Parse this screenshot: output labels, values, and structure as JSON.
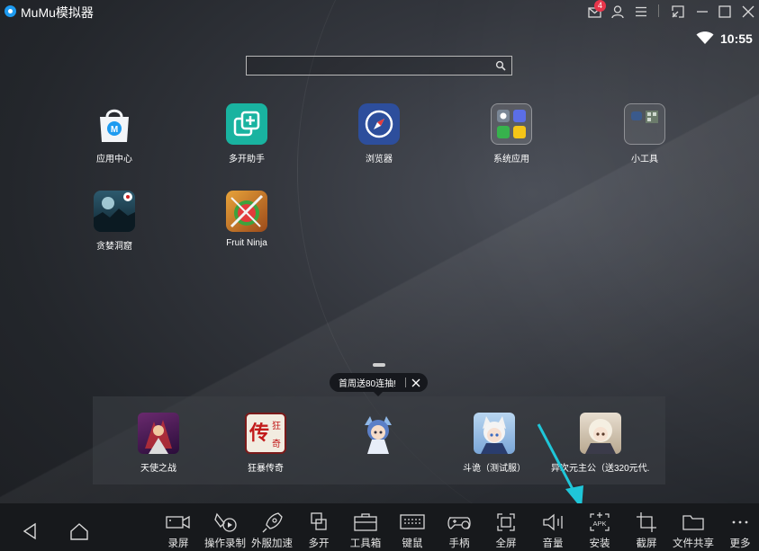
{
  "window": {
    "title": "MuMu模拟器",
    "notification_count": "4"
  },
  "status": {
    "time": "10:55"
  },
  "search": {
    "value": "",
    "placeholder": ""
  },
  "desktop": {
    "apps": [
      {
        "label": "应用中心",
        "icon": "app-center-icon"
      },
      {
        "label": "多开助手",
        "icon": "multi-instance-icon"
      },
      {
        "label": "浏览器",
        "icon": "browser-compass-icon"
      },
      {
        "label": "系统应用",
        "icon": "system-apps-folder-icon"
      },
      {
        "label": "小工具",
        "icon": "tools-folder-icon"
      },
      {
        "label": "贪婪洞窟",
        "icon": "game-cave-icon"
      },
      {
        "label": "Fruit Ninja",
        "icon": "fruit-ninja-icon"
      }
    ]
  },
  "dock": {
    "promo_text": "首周送80连抽!",
    "items": [
      {
        "label": "天使之战",
        "icon": "angel-war-game-icon"
      },
      {
        "label": "狂暴传奇",
        "icon": "legend-game-icon"
      },
      {
        "label": "",
        "icon": "anime-girl-game-icon"
      },
      {
        "label": "斗诡（测试服）",
        "icon": "cat-girl-game-icon"
      },
      {
        "label": "异次元主公（送320元代...",
        "icon": "dimension-lord-game-icon"
      }
    ]
  },
  "toolbar": {
    "items": [
      {
        "label": "录屏",
        "icon": "record-screen-icon"
      },
      {
        "label": "操作录制",
        "icon": "operation-record-icon"
      },
      {
        "label": "外服加速",
        "icon": "rocket-accelerate-icon"
      },
      {
        "label": "多开",
        "icon": "multi-open-icon"
      },
      {
        "label": "工具箱",
        "icon": "toolbox-icon"
      },
      {
        "label": "键鼠",
        "icon": "keyboard-icon"
      },
      {
        "label": "手柄",
        "icon": "gamepad-icon"
      },
      {
        "label": "全屏",
        "icon": "fullscreen-icon"
      },
      {
        "label": "音量",
        "icon": "volume-icon"
      },
      {
        "label": "安装",
        "icon": "install-apk-icon"
      },
      {
        "label": "截屏",
        "icon": "crop-screenshot-icon"
      },
      {
        "label": "文件共享",
        "icon": "folder-share-icon"
      },
      {
        "label": "更多",
        "icon": "more-dots-icon"
      }
    ],
    "apk_text": "APK"
  },
  "colors": {
    "accent": "#1e9bf0",
    "badge": "#e8364b",
    "annotation_arrow": "#1fc6d8",
    "toolbar_bg": "#17191c"
  }
}
